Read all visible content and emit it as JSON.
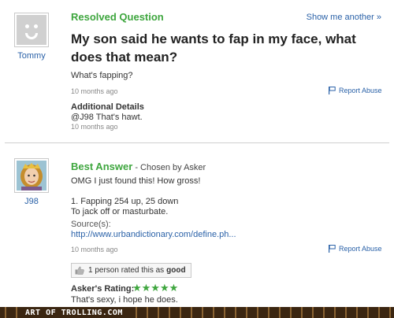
{
  "question": {
    "section_title": "Resolved Question",
    "show_another": "Show me another »",
    "asker_name": "Tommy",
    "title": "My son said he wants to fap in my face, what does that mean?",
    "body": "What's fapping?",
    "time": "10 months ago",
    "report_label": "Report Abuse",
    "details_title": "Additional Details",
    "details_body": "@J98 That's hawt.",
    "details_time": "10 months ago"
  },
  "answer": {
    "section_title": "Best Answer",
    "chosen_by": " - Chosen by Asker",
    "answerer_name": "J98",
    "line1": "OMG I just found this! How gross!",
    "line2": "1. Fapping 254 up, 25 down",
    "line3": "To jack off or masturbate.",
    "source_label": "Source(s):",
    "source_link": "http://www.urbandictionary.com/define.ph...",
    "time": "10 months ago",
    "report_label": "Report Abuse",
    "rated_prefix": "1 person rated this as",
    "rated_value": "good",
    "rating_label": "Asker's Rating:",
    "rating_stars": "★★★★★",
    "rating_value": 5,
    "rating_comment": "That's sexy, i hope he does."
  },
  "footer": {
    "text": "ART OF TROLLING.COM"
  },
  "colors": {
    "accent_green": "#3ea63e",
    "link_blue": "#2b62a8",
    "footer_brown": "#3b2611"
  }
}
